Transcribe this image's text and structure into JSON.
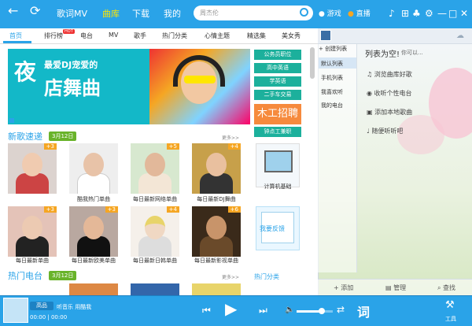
{
  "nav": {
    "back": "←",
    "refresh": "⟳",
    "items": [
      "歌词MV",
      "曲库",
      "下载",
      "我的"
    ],
    "active": "曲库"
  },
  "search": {
    "placeholder": "周杰伦"
  },
  "topright": {
    "game": "游戏",
    "live": "直播"
  },
  "tabs": [
    "首页",
    "排行榜",
    "电台",
    "MV",
    "歌手",
    "热门分类",
    "心情主题",
    "精选集",
    "美女秀"
  ],
  "hot_badge": "HOT",
  "banner": {
    "big1": "夜",
    "sub": "最爱DJ宠爱的",
    "big2": "店舞曲"
  },
  "side_buttons": [
    "公务员职位",
    "高中英语",
    "学英语",
    "二手车交易"
  ],
  "recruit": "木工招聘",
  "hangzhou": "钟点工兼职",
  "pc_caption": "计算机基础",
  "new_songs": {
    "title": "新歌速递",
    "date": "3月12日",
    "more": "更多>>"
  },
  "row1": [
    {
      "count": "+3",
      "caption": ""
    },
    {
      "count": "",
      "caption": "酷我热门单曲"
    },
    {
      "count": "+5",
      "caption": "每日最新网络单曲"
    },
    {
      "count": "+4",
      "caption": "每日最新DJ舞曲"
    }
  ],
  "row2": [
    {
      "count": "+3",
      "caption": "每日最新单曲"
    },
    {
      "count": "+3",
      "caption": "每日最新欧美单曲"
    },
    {
      "count": "+4",
      "caption": "每日最新日韩单曲"
    },
    {
      "count": "+6",
      "caption": "每日最新影视单曲"
    }
  ],
  "feedback": "我要反馈",
  "radio": {
    "title": "热门电台",
    "date": "3月12日",
    "more": "更多>>",
    "cat": "热门分类"
  },
  "right": {
    "create": "+ 创建列表",
    "lists": [
      "默认列表",
      "手机列表",
      "我喜欢听",
      "我的电台"
    ],
    "empty_title": "列表为空!",
    "empty_sub": "你可以...",
    "items": [
      "浏览曲库好歌",
      "收听个性电台",
      "添加本地歌曲",
      "随便听听吧"
    ],
    "foot": [
      "+ 添加",
      "管理",
      "查找"
    ]
  },
  "player": {
    "quality": "高品",
    "source": "听音乐 用酷我",
    "time": "00:00 | 00:00",
    "lyric": "词",
    "tool": "工具"
  }
}
